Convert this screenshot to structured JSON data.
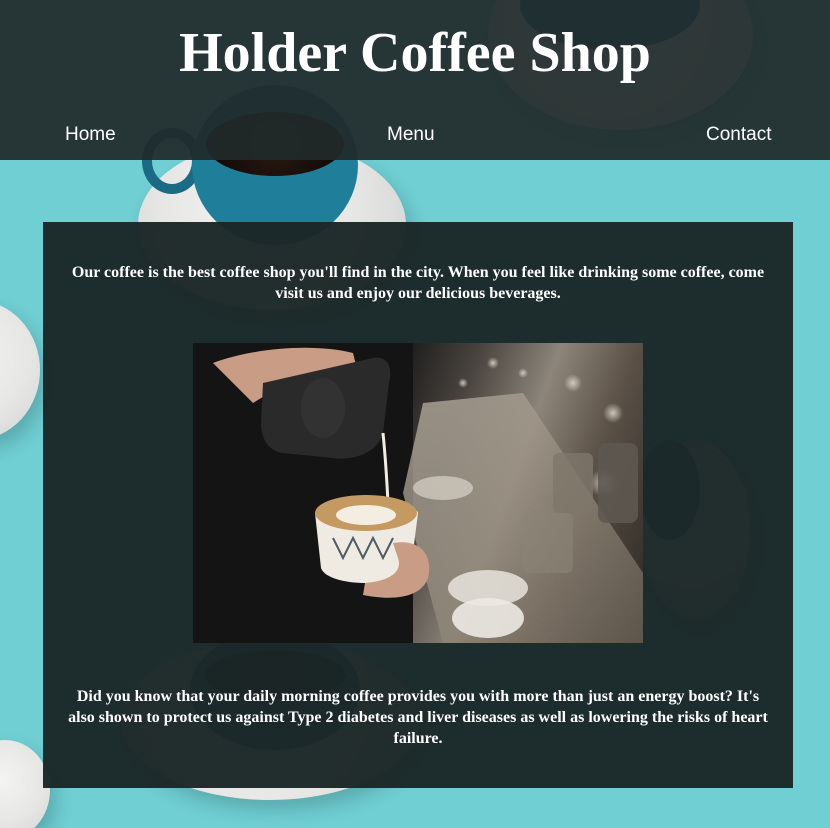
{
  "header": {
    "title": "Holder Coffee Shop"
  },
  "nav": {
    "items": [
      {
        "label": "Home"
      },
      {
        "label": "Menu"
      },
      {
        "label": "Contact"
      }
    ]
  },
  "main": {
    "intro": "Our coffee is the best coffee shop you'll find in the city. When you feel like drinking some coffee, come visit us and enjoy our delicious beverages.",
    "image_icon": "latte-art-photo",
    "fact": "Did you know that your daily morning coffee provides you with more than just an energy boost? It's also shown to protect us against Type 2 diabetes and liver diseases as well as lowering the risks of heart failure."
  },
  "colors": {
    "background": "#6fcfd3",
    "header_bg": "#202a2a",
    "panel_bg": "#1b2626",
    "text": "#ffffff",
    "cup_blue": "#1f7f9a"
  }
}
